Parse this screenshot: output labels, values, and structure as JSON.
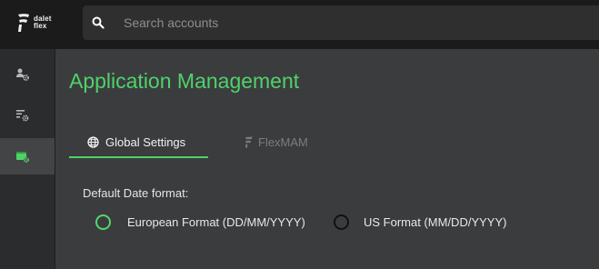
{
  "logo": {
    "line1": "dalet",
    "line2": "flex"
  },
  "search": {
    "placeholder": "Search accounts"
  },
  "sidebar": {
    "items": [
      {
        "icon": "users-gear-icon",
        "active": false
      },
      {
        "icon": "list-gear-icon",
        "active": false
      },
      {
        "icon": "app-settings-icon",
        "active": true
      }
    ]
  },
  "main": {
    "title": "Application Management",
    "tabs": [
      {
        "label": "Global Settings",
        "icon": "globe-icon",
        "active": true
      },
      {
        "label": "FlexMAM",
        "icon": "flex-logo-icon",
        "active": false
      }
    ],
    "date_format": {
      "label": "Default Date format:",
      "options": [
        {
          "label": "European Format (DD/MM/YYYY)",
          "selected": true
        },
        {
          "label": "US Format (MM/DD/YYYY)",
          "selected": false
        }
      ]
    }
  },
  "colors": {
    "accent": "#4fd26a",
    "background": "#3b3c3e",
    "topbar": "#1b1b1c",
    "sidebar": "#2b2c2e"
  }
}
